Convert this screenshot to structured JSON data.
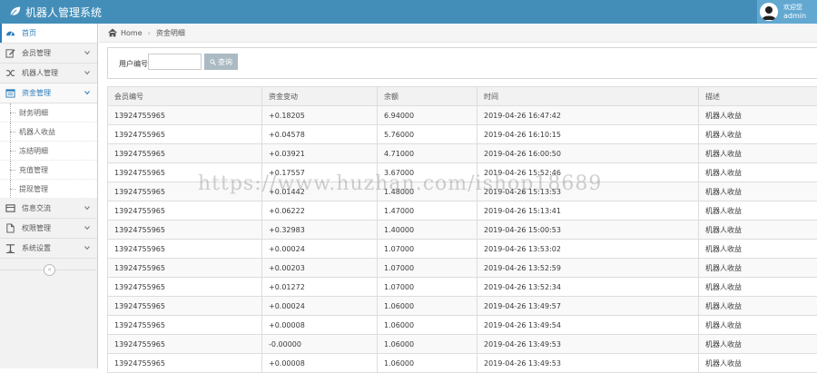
{
  "header": {
    "app_title": "机器人管理系统",
    "user_greeting": "欢迎您",
    "username": "admin"
  },
  "sidebar": {
    "items": [
      {
        "label": "首页",
        "icon": "dashboard-icon",
        "state": "active"
      },
      {
        "label": "会员管理",
        "icon": "edit-icon",
        "state": "closed"
      },
      {
        "label": "机器人管理",
        "icon": "shuffle-icon",
        "state": "closed"
      },
      {
        "label": "资金管理",
        "icon": "calendar-icon",
        "state": "open"
      }
    ],
    "subitems": [
      "财务明细",
      "机器人收益",
      "冻结明细",
      "充值管理",
      "提现管理"
    ],
    "items_after": [
      {
        "label": "信息交流",
        "icon": "message-icon"
      },
      {
        "label": "权限管理",
        "icon": "file-icon"
      },
      {
        "label": "系统设置",
        "icon": "text-icon"
      }
    ],
    "collapse_glyph": "«"
  },
  "breadcrumb": {
    "home": "Home",
    "current": "资金明细"
  },
  "search": {
    "label": "用户编号",
    "input_value": "",
    "button": "查询"
  },
  "table": {
    "headers": [
      "会员编号",
      "资金变动",
      "余额",
      "时间",
      "描述"
    ],
    "rows": [
      [
        "13924755965",
        "+0.18205",
        "6.94000",
        "2019-04-26 16:47:42",
        "机器人收益"
      ],
      [
        "13924755965",
        "+0.04578",
        "5.76000",
        "2019-04-26 16:10:15",
        "机器人收益"
      ],
      [
        "13924755965",
        "+0.03921",
        "4.71000",
        "2019-04-26 16:00:50",
        "机器人收益"
      ],
      [
        "13924755965",
        "+0.17557",
        "3.67000",
        "2019-04-26 15:52:46",
        "机器人收益"
      ],
      [
        "13924755965",
        "+0.01442",
        "1.48000",
        "2019-04-26 15:13:53",
        "机器人收益"
      ],
      [
        "13924755965",
        "+0.06222",
        "1.47000",
        "2019-04-26 15:13:41",
        "机器人收益"
      ],
      [
        "13924755965",
        "+0.32983",
        "1.40000",
        "2019-04-26 15:00:53",
        "机器人收益"
      ],
      [
        "13924755965",
        "+0.00024",
        "1.07000",
        "2019-04-26 13:53:02",
        "机器人收益"
      ],
      [
        "13924755965",
        "+0.00203",
        "1.07000",
        "2019-04-26 13:52:59",
        "机器人收益"
      ],
      [
        "13924755965",
        "+0.01272",
        "1.07000",
        "2019-04-26 13:52:34",
        "机器人收益"
      ],
      [
        "13924755965",
        "+0.00024",
        "1.06000",
        "2019-04-26 13:49:57",
        "机器人收益"
      ],
      [
        "13924755965",
        "+0.00008",
        "1.06000",
        "2019-04-26 13:49:54",
        "机器人收益"
      ],
      [
        "13924755965",
        "-0.00000",
        "1.06000",
        "2019-04-26 13:49:53",
        "机器人收益"
      ],
      [
        "13924755965",
        "+0.00008",
        "1.06000",
        "2019-04-26 13:49:53",
        "机器人收益"
      ]
    ]
  },
  "watermark": "https://www.huzhan.com/ishop18689",
  "colors": {
    "navbar": "#438eb9",
    "user_box": "#62a8d1",
    "active_accent": "#2b7dbc",
    "search_button": "#abbac3"
  }
}
